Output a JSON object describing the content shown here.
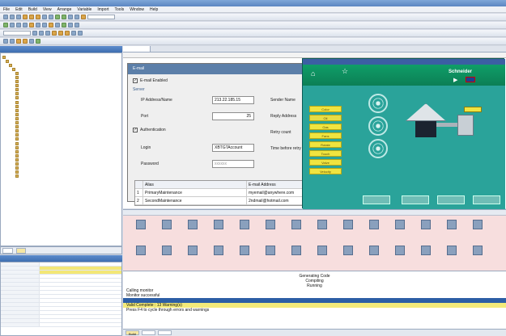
{
  "menubar": {
    "items": [
      "File",
      "Edit",
      "Build",
      "View",
      "Arrange",
      "Variable",
      "Import",
      "Tools",
      "Window",
      "Help"
    ]
  },
  "email_dialog": {
    "title": "E-mail",
    "email_enabled_label": "E-mail Enabled",
    "server_group": "Server",
    "ip_label": "IP Address/Name",
    "ip_value": "213.22.185.15",
    "port_label": "Port",
    "port_value": "25",
    "auth_label": "Authentication",
    "login_label": "Login",
    "login_value": "XBTGTAccount",
    "password_label": "Password",
    "password_value": "xxxxxx",
    "sender_label": "Sender Name",
    "reply_label": "Reply Address",
    "retry_label": "Retry count",
    "time_label": "Time before retry",
    "table": {
      "headers": [
        "",
        "Alias",
        "E-mail Address"
      ],
      "rows": [
        [
          "1",
          "PrimaryMaintenance",
          "myemail@anywhere.com"
        ],
        [
          "2",
          "SecondMaintenance",
          "2ndmail@hotmail.com"
        ]
      ]
    }
  },
  "hmi_panel": {
    "brand": "Schneider",
    "buttons": [
      "Color",
      "Oil",
      "Gas",
      "Fans",
      "Rotate",
      "Touch",
      "Valve",
      "Velocity"
    ]
  },
  "output": {
    "lines": [
      {
        "text": "Generating Code",
        "style": "center"
      },
      {
        "text": "Compiling",
        "style": "center"
      },
      {
        "text": "Running",
        "style": "center"
      },
      {
        "text": "Calling monitor",
        "style": ""
      },
      {
        "text": "Monitor successful",
        "style": ""
      },
      {
        "text": "Valid Complete : 13 Warning(s)",
        "style": "warn"
      },
      {
        "text": "Press F4 to cycle through errors and warnings",
        "style": ""
      }
    ],
    "tabs": [
      "Build"
    ]
  },
  "colors": {
    "teal": "#1f8f86",
    "accent_yellow": "#f0e440",
    "titlebar": "#5a86c2"
  }
}
